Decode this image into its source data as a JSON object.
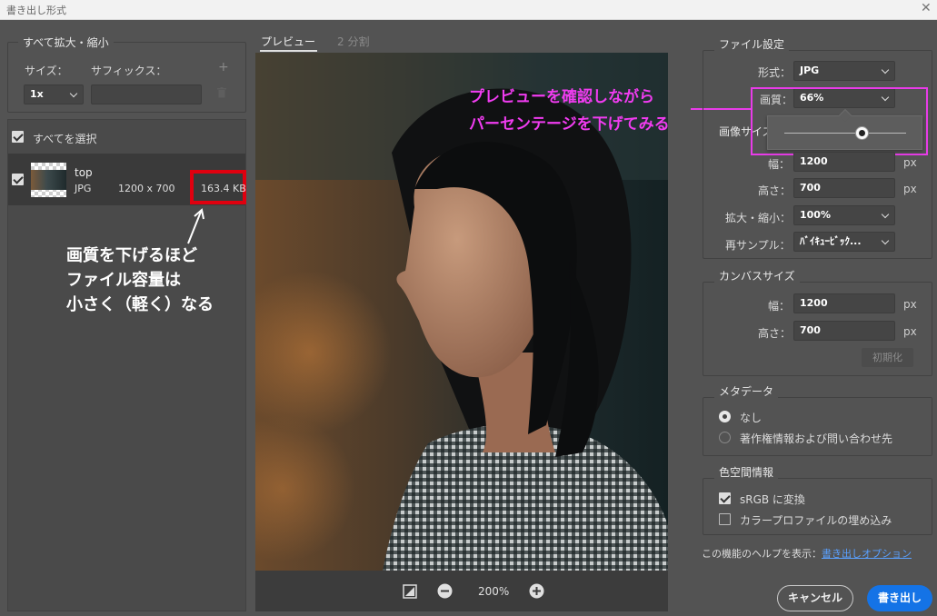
{
  "window": {
    "title": "書き出し形式"
  },
  "scale_panel": {
    "legend": "すべて拡大・縮小",
    "size_label": "サイズ：",
    "suffix_label": "サフィックス：",
    "size_value": "1x",
    "suffix_value": ""
  },
  "asset_list": {
    "select_all_label": "すべてを選択",
    "select_all_checked": true,
    "items": [
      {
        "name": "top",
        "format": "JPG",
        "dimensions": "1200 x 700",
        "file_size": "163.4 KB",
        "checked": true
      }
    ]
  },
  "preview": {
    "tabs": [
      {
        "label": "プレビュー",
        "active": true
      },
      {
        "label": "2 分割",
        "active": false
      }
    ],
    "zoom": "200%"
  },
  "file_settings": {
    "legend": "ファイル設定",
    "format_label": "形式：",
    "format_value": "JPG",
    "quality_label": "画質：",
    "quality_value": "66%",
    "quality_slider_level": 0.66
  },
  "image_size": {
    "legend_partial": "画像サイズ",
    "width_label": "幅：",
    "width_value": "1200",
    "height_label": "高さ：",
    "height_value": "700",
    "unit": "px",
    "scale_label": "拡大・縮小：",
    "scale_value": "100%",
    "resample_label": "再サンプル：",
    "resample_value": "ﾊﾞｲｷｭｰﾋﾞｯｸ..."
  },
  "canvas_size": {
    "legend": "カンバスサイズ",
    "width_label": "幅：",
    "width_value": "1200",
    "height_label": "高さ：",
    "height_value": "700",
    "unit": "px",
    "reset_label": "初期化"
  },
  "metadata": {
    "legend": "メタデータ",
    "options": [
      {
        "label": "なし",
        "selected": true
      },
      {
        "label": "著作権情報および問い合わせ先",
        "selected": false
      }
    ]
  },
  "color_space": {
    "legend": "色空間情報",
    "options": [
      {
        "label": "sRGB に変換",
        "checked": true
      },
      {
        "label": "カラープロファイルの埋め込み",
        "checked": false
      }
    ]
  },
  "help": {
    "prefix": "この機能のヘルプを表示：",
    "link": "書き出しオプション"
  },
  "buttons": {
    "cancel": "キャンセル",
    "export": "書き出し"
  },
  "annotations": {
    "left_lines": [
      "画質を下げるほど",
      "ファイル容量は",
      "小さく（軽く）なる"
    ],
    "right_lines": [
      "プレビューを確認しながら",
      "パーセンテージを下げてみる"
    ]
  },
  "colors": {
    "accent": "#1473e6",
    "highlight_red": "#e0000f",
    "highlight_magenta": "#e83ce8",
    "link": "#5aa0ff"
  }
}
